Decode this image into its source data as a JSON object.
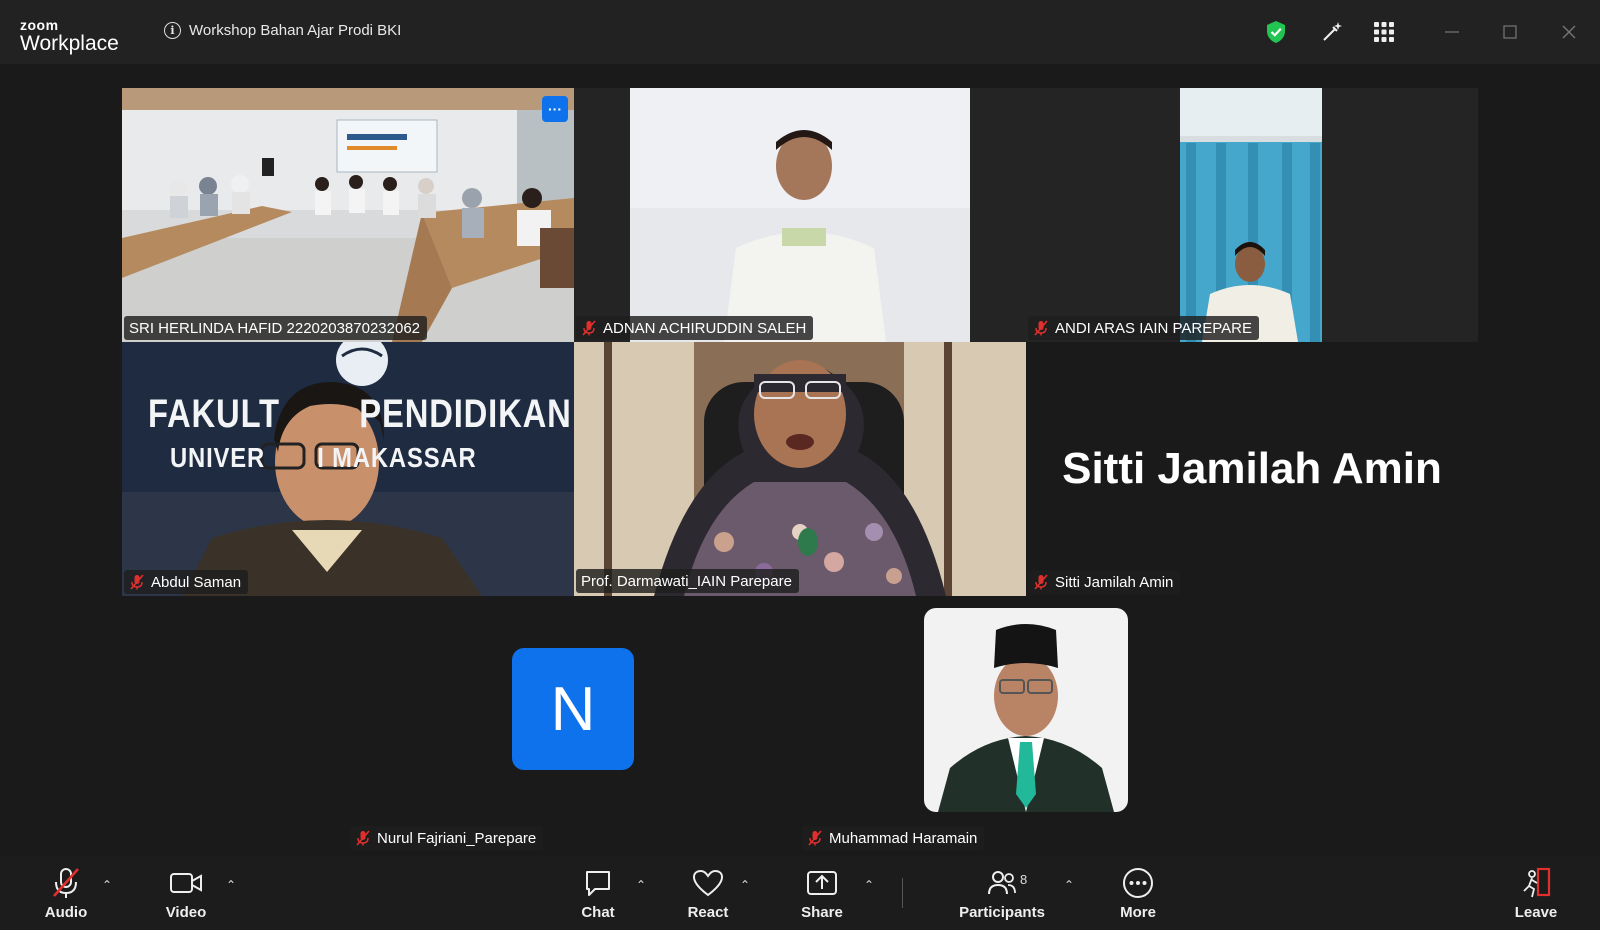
{
  "app": {
    "brand_top": "zoom",
    "brand_bottom": "Workplace",
    "meeting_title": "Workshop Bahan Ajar Prodi BKI"
  },
  "colors": {
    "accent": "#0e72ed",
    "active_speaker": "#2fd46d",
    "muted": "#e0302e",
    "leave": "#e0302e"
  },
  "icons": {
    "info": "info-icon",
    "security": "shield-check-icon",
    "whiteboard": "magic-pen-icon",
    "apps": "grid-icon",
    "minimize": "minimize-icon",
    "maximize": "maximize-icon",
    "close": "close-icon"
  },
  "tiles": {
    "t1": {
      "name": "SRI HERLINDA HAFID 2220203870232062",
      "more": "···"
    },
    "t2": {
      "name": "ADNAN ACHIRUDDIN SALEH"
    },
    "t3": {
      "name": "ANDI ARAS IAIN PAREPARE"
    },
    "t4": {
      "name": "Abdul Saman",
      "bg_line1": "FAKULT        PENDIDIKAN",
      "bg_line2": "UNIVER       I MAKASSAR"
    },
    "t5": {
      "name": "Prof. Darmawati_IAIN Parepare"
    },
    "t6": {
      "name": "Sitti Jamilah Amin",
      "display": "Sitti Jamilah Amin"
    },
    "t7": {
      "name": "Nurul Fajriani_Parepare",
      "initial": "N"
    },
    "t8": {
      "name": "Muhammad Haramain"
    }
  },
  "toolbar": {
    "audio": "Audio",
    "video": "Video",
    "chat": "Chat",
    "react": "React",
    "share": "Share",
    "participants": "Participants",
    "participants_count": "8",
    "more": "More",
    "leave": "Leave",
    "caret": "⌃"
  }
}
